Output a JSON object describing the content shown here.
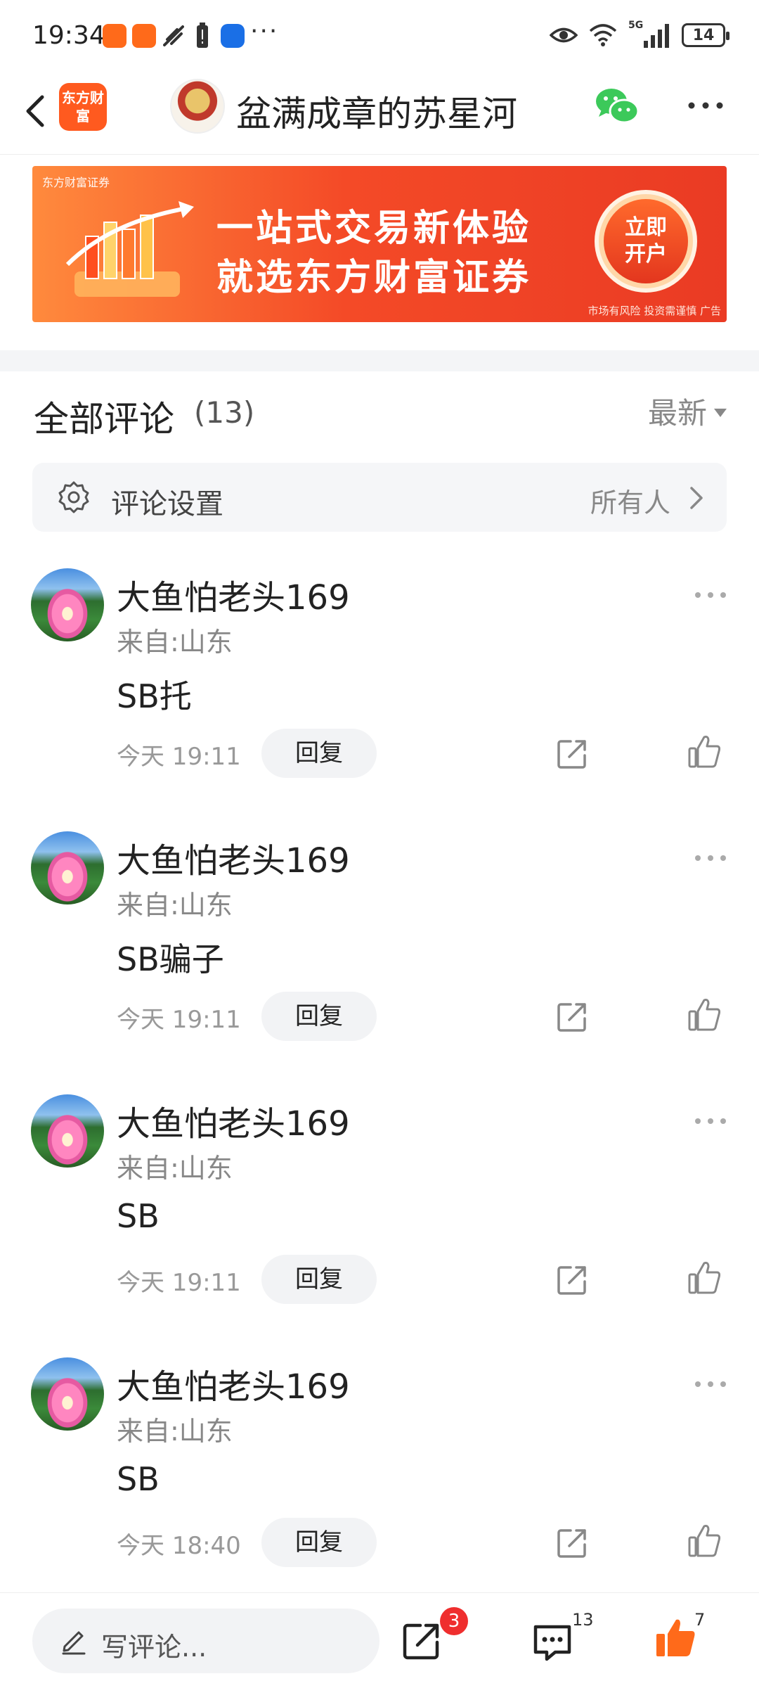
{
  "status_bar": {
    "time": "19:34",
    "more": "···",
    "network": "5G",
    "battery": "14"
  },
  "header": {
    "logo_text": "东方财富",
    "title": "盆满成章的苏星河"
  },
  "banner": {
    "brand": "东方财富证券",
    "line1": "一站式交易新体验",
    "line2": "就选东方财富证券",
    "cta_line1": "立即",
    "cta_line2": "开户",
    "disclaimer": "市场有风险 投资需谨慎 广告"
  },
  "comments_section": {
    "title": "全部评论",
    "count": "(13)",
    "sort_label": "最新",
    "settings_label": "评论设置",
    "settings_value": "所有人"
  },
  "comments": [
    {
      "name": "大鱼怕老头169",
      "location": "来自:山东",
      "text": "SB托",
      "time": "今天 19:11",
      "reply_label": "回复"
    },
    {
      "name": "大鱼怕老头169",
      "location": "来自:山东",
      "text": "SB骗子",
      "time": "今天 19:11",
      "reply_label": "回复"
    },
    {
      "name": "大鱼怕老头169",
      "location": "来自:山东",
      "text": "SB",
      "time": "今天 19:11",
      "reply_label": "回复"
    },
    {
      "name": "大鱼怕老头169",
      "location": "来自:山东",
      "text": "SB",
      "time": "今天 18:40",
      "reply_label": "回复"
    }
  ],
  "bottom_bar": {
    "placeholder": "写评论...",
    "share_badge": "3",
    "comment_count": "13",
    "like_count": "7"
  },
  "colors": {
    "accent": "#ff5a1f",
    "like_active": "#ff6a1a",
    "badge": "#ef2e2e",
    "wechat": "#3cc95a"
  },
  "icons": {
    "back": "chevron-left-icon",
    "wechat": "wechat-icon",
    "more": "more-horizontal-icon",
    "settings": "gear-icon",
    "share": "share-icon",
    "like": "thumbs-up-icon",
    "write": "pencil-icon",
    "comment": "comment-icon"
  }
}
